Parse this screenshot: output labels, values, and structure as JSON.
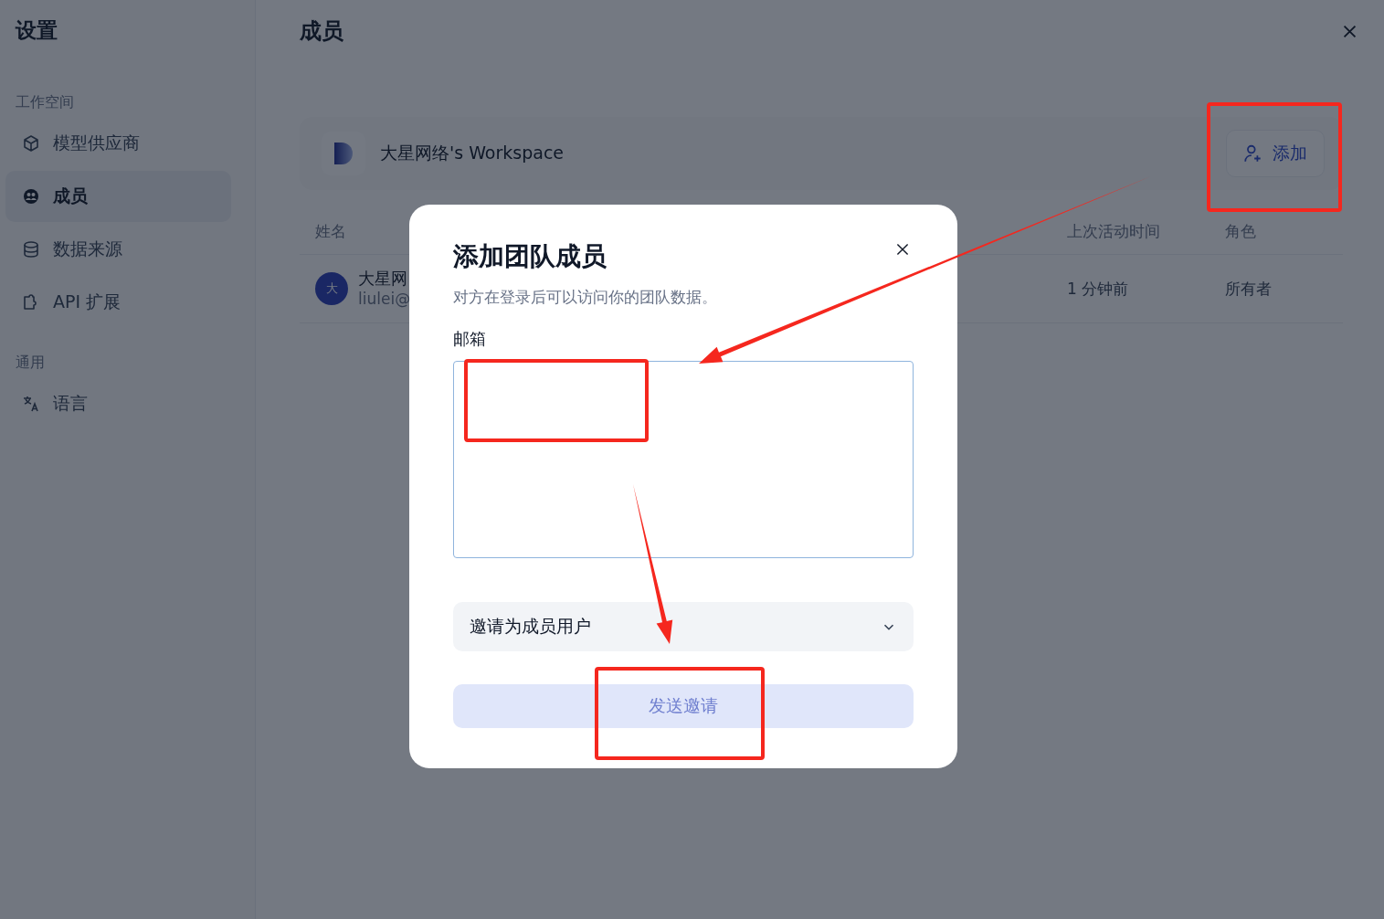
{
  "sidebar": {
    "title": "设置",
    "sections": [
      {
        "label": "工作空间",
        "items": [
          {
            "label": "模型供应商",
            "selected": false
          },
          {
            "label": "成员",
            "selected": true
          },
          {
            "label": "数据来源",
            "selected": false
          },
          {
            "label": "API 扩展",
            "selected": false
          }
        ]
      },
      {
        "label": "通用",
        "items": [
          {
            "label": "语言",
            "selected": false
          }
        ]
      }
    ]
  },
  "main": {
    "title": "成员",
    "workspace": {
      "name": "大星网络's Workspace",
      "add_button": "添加"
    },
    "table": {
      "columns": [
        "姓名",
        "上次活动时间",
        "角色"
      ],
      "rows": [
        {
          "avatar": "大",
          "name": "大星网",
          "email": "liulei@",
          "last_active": "1 分钟前",
          "role": "所有者"
        }
      ]
    }
  },
  "dialog": {
    "title": "添加团队成员",
    "description": "对方在登录后可以访问你的团队数据。",
    "email_label": "邮箱",
    "role_select": "邀请为成员用户",
    "submit": {
      "label": "发送邀请",
      "disabled": true
    }
  }
}
